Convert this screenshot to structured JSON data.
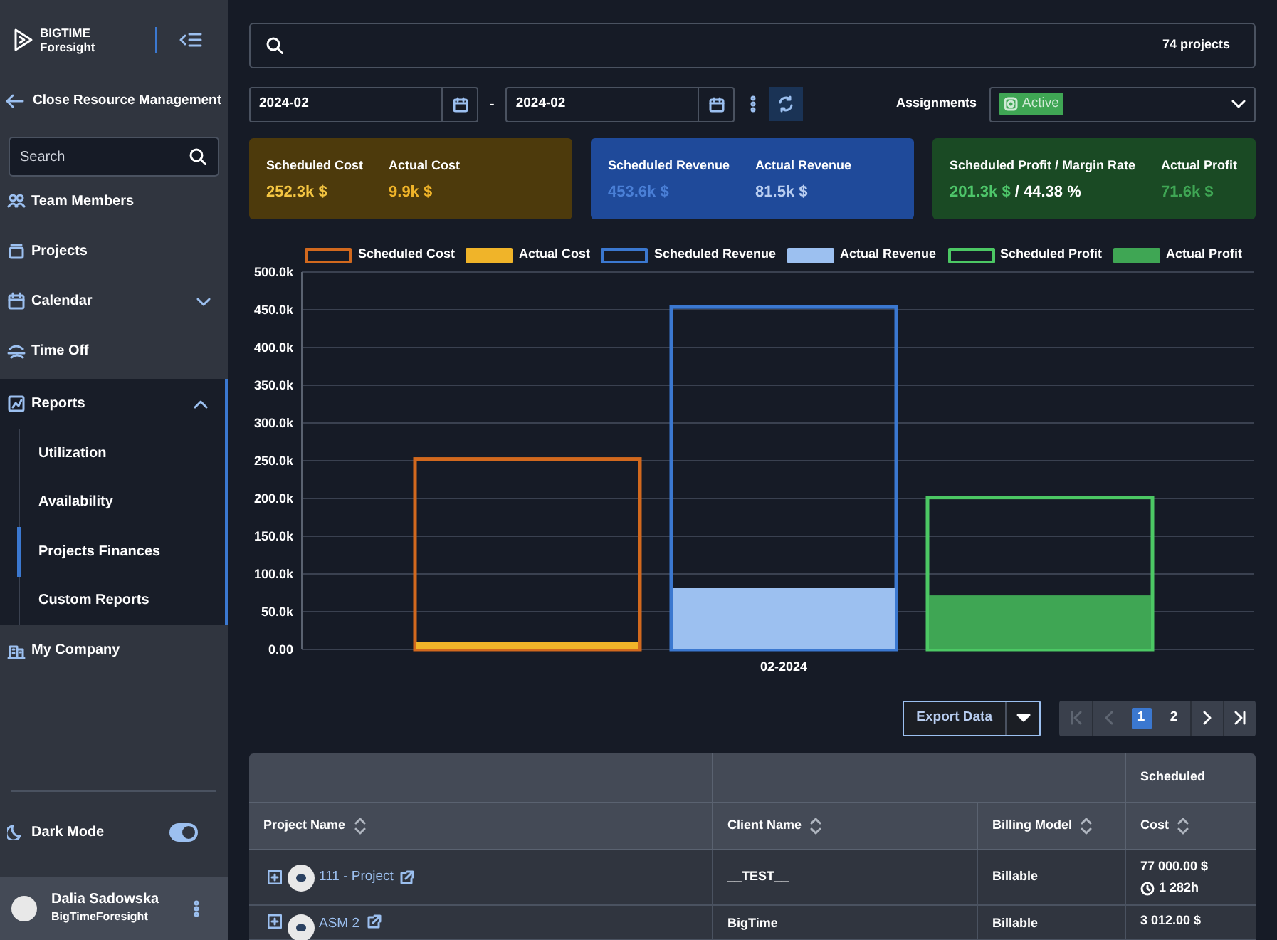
{
  "sidebar": {
    "logo": {
      "line1": "BIGTIME",
      "line2": "Foresight"
    },
    "back_link": "Close Resource Management",
    "search": {
      "placeholder": "Search"
    },
    "items": [
      {
        "label": "Team Members"
      },
      {
        "label": "Projects"
      },
      {
        "label": "Calendar",
        "expanded": false
      },
      {
        "label": "Time Off"
      },
      {
        "label": "Reports",
        "expanded": true,
        "children": [
          {
            "label": "Utilization",
            "selected": false
          },
          {
            "label": "Availability",
            "selected": false
          },
          {
            "label": "Projects Finances",
            "selected": true
          },
          {
            "label": "Custom Reports",
            "selected": false
          }
        ]
      },
      {
        "label": "My Company"
      }
    ],
    "dark_mode": {
      "label": "Dark Mode",
      "on": true
    },
    "user": {
      "name": "Dalia Sadowska",
      "org": "BigTimeForesight"
    }
  },
  "search": {
    "count": "74 projects"
  },
  "filters": {
    "date_from": "2024-02",
    "separator": "-",
    "date_to": "2024-02",
    "assignments_label": "Assignments",
    "assignments_value": "Active"
  },
  "cards": [
    {
      "kind": "cost",
      "metrics": [
        {
          "label": "Scheduled Cost",
          "value": "252.3k $"
        },
        {
          "label": "Actual Cost",
          "value": "9.9k $"
        }
      ]
    },
    {
      "kind": "revenue",
      "metrics": [
        {
          "label": "Scheduled Revenue",
          "value": "453.6k $"
        },
        {
          "label": "Actual Revenue",
          "value": "81.5k $"
        }
      ]
    },
    {
      "kind": "profit",
      "metrics": [
        {
          "label": "Scheduled Profit / Margin Rate",
          "value": "201.3k $",
          "suffix": " / 44.38 %"
        },
        {
          "label": "Actual Profit",
          "value": "71.6k $"
        }
      ]
    }
  ],
  "chart_data": {
    "type": "bar",
    "grid": true,
    "categories": [
      "02-2024"
    ],
    "ylim": [
      0,
      500000
    ],
    "yticks": [
      {
        "value": 0,
        "label": "0.00"
      },
      {
        "value": 50000,
        "label": "50.0k"
      },
      {
        "value": 100000,
        "label": "100.0k"
      },
      {
        "value": 150000,
        "label": "150.0k"
      },
      {
        "value": 200000,
        "label": "200.0k"
      },
      {
        "value": 250000,
        "label": "250.0k"
      },
      {
        "value": 300000,
        "label": "300.0k"
      },
      {
        "value": 350000,
        "label": "350.0k"
      },
      {
        "value": 400000,
        "label": "400.0k"
      },
      {
        "value": 450000,
        "label": "450.0k"
      },
      {
        "value": 500000,
        "label": "500.0k"
      }
    ],
    "series": [
      {
        "name": "Scheduled Cost",
        "color": "#d2691e",
        "values": [
          252300
        ]
      },
      {
        "name": "Actual Cost",
        "color": "#f0b429",
        "values": [
          9900
        ]
      },
      {
        "name": "Scheduled Revenue",
        "color": "#3b78d0",
        "values": [
          453600
        ]
      },
      {
        "name": "Actual Revenue",
        "color": "#9cc0f0",
        "values": [
          81500
        ]
      },
      {
        "name": "Scheduled Profit",
        "color": "#4cc864",
        "values": [
          201300
        ]
      },
      {
        "name": "Actual Profit",
        "color": "#3fa654",
        "values": [
          71600
        ]
      }
    ]
  },
  "export": {
    "label": "Export Data"
  },
  "pagination": {
    "first": {
      "disabled": true
    },
    "prev": {
      "disabled": true
    },
    "pages": [
      {
        "label": "1",
        "selected": true
      },
      {
        "label": "2",
        "selected": false
      }
    ],
    "next": {
      "disabled": false
    },
    "last": {
      "disabled": false
    }
  },
  "table": {
    "group_header": "Scheduled",
    "columns": [
      "Project Name",
      "Client Name",
      "Billing Model",
      "Cost"
    ],
    "rows": [
      {
        "project": "111 - Project",
        "client": "__TEST__",
        "billing": "Billable",
        "cost": "77 000.00 $",
        "hours": "1 282h"
      },
      {
        "project": "ASM 2",
        "client": "BigTime",
        "billing": "Billable",
        "cost": "3 012.00 $"
      }
    ]
  }
}
